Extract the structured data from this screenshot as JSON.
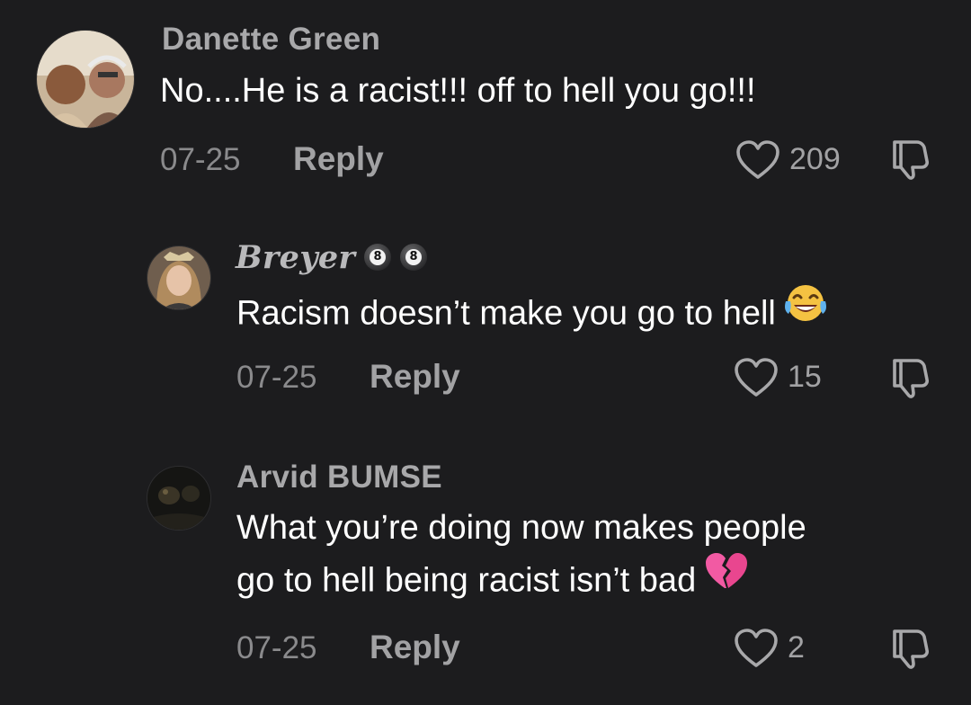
{
  "comments": [
    {
      "username": "Danette Green",
      "text": "No....He is a racist!!! off to hell you go!!!",
      "date": "07-25",
      "reply_label": "Reply",
      "likes": "209",
      "avatar_icon": "user-photo-couple"
    },
    {
      "username": "Breyer",
      "badges": [
        "8",
        "8"
      ],
      "badge_icon": "eight-ball-icon",
      "text": "Racism doesn’t make you go to hell",
      "emoji": "tears-of-joy-emoji",
      "date": "07-25",
      "reply_label": "Reply",
      "likes": "15",
      "avatar_icon": "user-photo-girl"
    },
    {
      "username": "Arvid BUMSE",
      "text_line1": "What you’re doing now makes people",
      "text_line2": "go to hell being racist isn’t bad",
      "emoji": "broken-heart-emoji",
      "date": "07-25",
      "reply_label": "Reply",
      "likes": "2",
      "avatar_icon": "user-photo-dark"
    }
  ],
  "colors": {
    "background": "#1c1c1e",
    "text": "#ffffff",
    "muted": "#8a8a8c",
    "username": "#a8a8aa"
  }
}
